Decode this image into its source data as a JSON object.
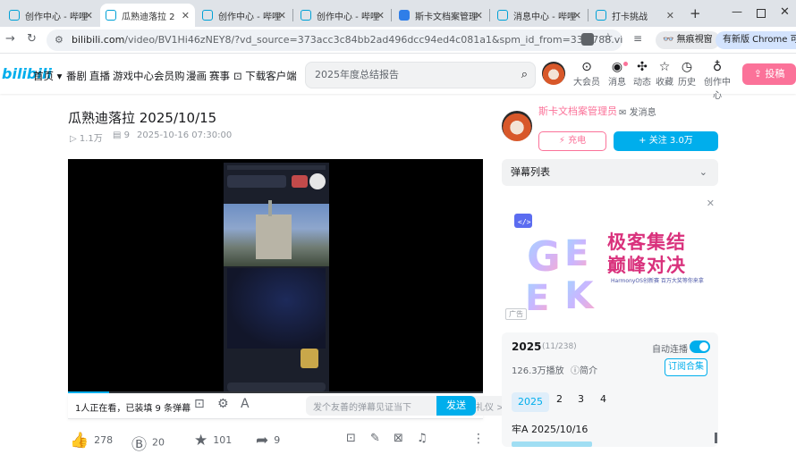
{
  "browser": {
    "tabs": [
      {
        "label": "创作中心 - 哔哩"
      },
      {
        "label": "瓜熟迪落拉 2"
      },
      {
        "label": "创作中心 - 哔哩"
      },
      {
        "label": "创作中心 - 哔哩"
      },
      {
        "label": "斯卡文档案管理"
      },
      {
        "label": "消息中心 - 哔哩"
      },
      {
        "label": "打卡挑战"
      }
    ],
    "new_tab": "+",
    "url_host": "bilibili.com",
    "url_path": "/video/BV1Hi46zNEY8/?vd_source=373acc3c84bb2ad496dcc94ed4c081a1&spm_id_from=333.788.videopod...",
    "incognito_label": "無痕視窗",
    "update_label": "有新版 Chrome 可安"
  },
  "site": {
    "logo": "bilibili",
    "nav": [
      "首页",
      "番剧",
      "直播",
      "游戏中心",
      "会员购",
      "漫画",
      "赛事",
      "下载客户端"
    ],
    "search_placeholder": "2025年度总结报告",
    "header_icons": [
      "大会员",
      "消息",
      "动态",
      "收藏",
      "历史",
      "创作中心"
    ],
    "upload_label": "投稿"
  },
  "video": {
    "title": "瓜熟迪落拉 2025/10/15",
    "views": "1.1万",
    "danmaku_count": "9",
    "datetime": "2025-10-16 07:30:00",
    "progress": 0.1,
    "viewers_text": "1人正在看，已装填 9 条弹幕",
    "dm_placeholder": "发个友善的弹幕见证当下",
    "dm_etiquette": "弹幕礼仪 >",
    "dm_send": "发送",
    "actions": {
      "like": "278",
      "coin": "20",
      "fav": "101",
      "share": "9"
    }
  },
  "uploader": {
    "name": "斯卡文档案管理员",
    "message_label": "发消息",
    "charge_label": "充电",
    "follow_label": "+ 关注 3.0万"
  },
  "sidebar": {
    "danmaku_list_label": "弹幕列表",
    "ad": {
      "headline_1": "极客集结",
      "headline_2": "巅峰对决",
      "subline": "HarmonyOS创新赛   百万大奖等你来拿",
      "badge": "广告"
    },
    "season": {
      "title": "2025",
      "count": "(11/238)",
      "autoplay_label": "自动连播",
      "plays": "126.3万播放",
      "intro_label": "简介",
      "subscribe_label": "订阅合集",
      "pages": [
        "2025",
        "2",
        "3",
        "4"
      ],
      "first_item": "牢A 2025/10/16"
    }
  }
}
